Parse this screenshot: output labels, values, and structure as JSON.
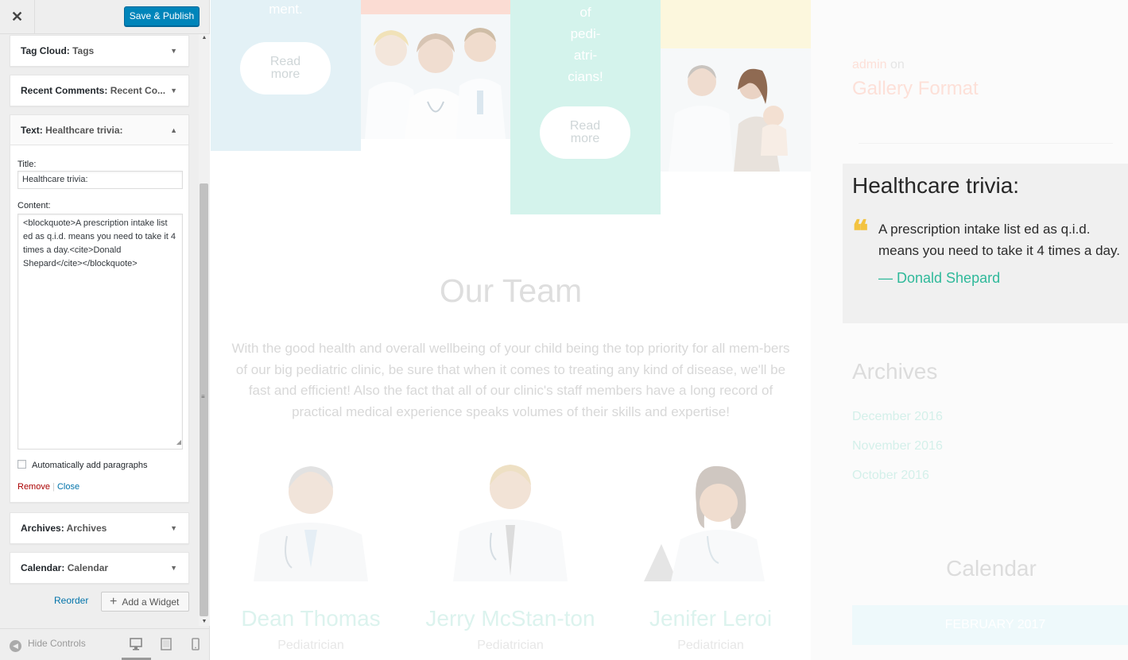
{
  "customizer": {
    "close_icon": "close-icon",
    "publish_label": "Save & Publish",
    "widgets": [
      {
        "type": "Tag Cloud:",
        "name": "Tags"
      },
      {
        "type": "Recent Comments:",
        "name": "Recent Co..."
      },
      {
        "type": "Text:",
        "name": "Healthcare trivia:"
      },
      {
        "type": "Archives:",
        "name": "Archives"
      },
      {
        "type": "Calendar:",
        "name": "Calendar"
      }
    ],
    "text_widget": {
      "title_label": "Title:",
      "title_value": "Healthcare trivia:",
      "content_label": "Content:",
      "content_value": "<blockquote>A prescription intake list ed as q.i.d. means you need to take it 4 times a day.<cite>Donald Shepard</cite></blockquote>",
      "autop_label": "Automatically add paragraphs",
      "autop_checked": false,
      "remove_label": "Remove",
      "separator": "|",
      "close_label": "Close"
    },
    "reorder_label": "Reorder",
    "add_widget_label": "Add a Widget",
    "hide_controls_label": "Hide Controls",
    "devices": [
      "desktop-icon",
      "tablet-icon",
      "mobile-icon"
    ],
    "active_device": "desktop",
    "accent_color": "#0085ba"
  },
  "preview": {
    "tile1_text": "ment.",
    "tile3_words": "of\npedi-\natri-\ncians!",
    "read_more": "Read\nmore",
    "team_title": "Our Team",
    "team_text": "With the good health and overall wellbeing of your child being the top priority for all mem-bers of our big pediatric clinic, be sure that when it comes to treating any kind of disease, we'll be fast and efficient! Also the fact that all of our clinic's staff members have a long record of practical medical experience speaks volumes of their skills and expertise!",
    "members": [
      {
        "name": "Dean Thomas",
        "role": "Pediatrician"
      },
      {
        "name": "Jerry McStan-ton",
        "role": "Pediatrician"
      },
      {
        "name": "Jenifer Leroi",
        "role": "Pediatrician"
      }
    ],
    "sidebar": {
      "post_meta_author": "admin",
      "post_meta_on": "on",
      "post_title": "Gallery Format",
      "trivia_title": "Healthcare trivia:",
      "trivia_quote": "A prescription intake list ed as q.i.d. means you need to take it 4 times a day.",
      "trivia_cite": "— Donald Shepard",
      "archives_title": "Archives",
      "archives": [
        "December 2016",
        "November 2016",
        "October 2016"
      ],
      "calendar_title": "Calendar",
      "calendar_month": "FEBRUARY 2017"
    }
  }
}
